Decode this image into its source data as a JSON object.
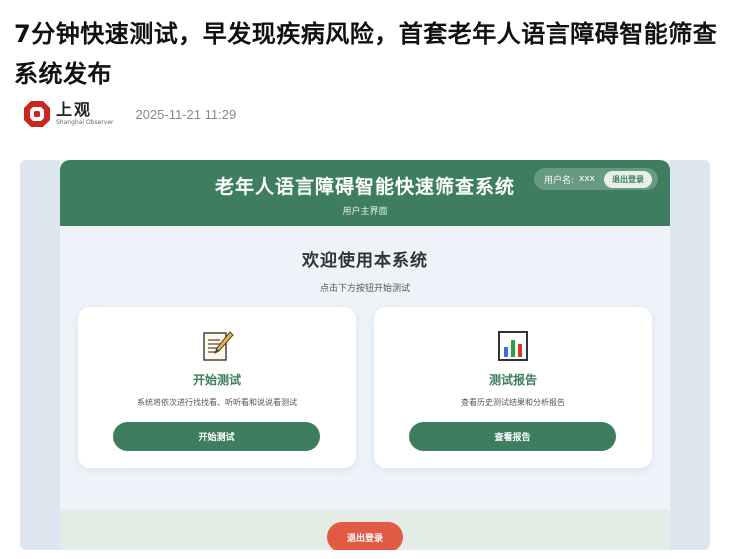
{
  "article": {
    "title": "7分钟快速测试，早发现疾病风险，首套老年人语言障碍智能筛查系统发布",
    "publisher_name_cn": "上观",
    "publisher_name_en": "Shanghai Observer",
    "date": "2025-11-21 11:29"
  },
  "app": {
    "title": "老年人语言障碍智能快速筛查系统",
    "subtitle": "用户主界面",
    "user_label": "用户名:",
    "user_name": "xxx",
    "logout_small_label": "退出登录",
    "welcome_title": "欢迎使用本系统",
    "welcome_subtitle": "点击下方按钮开始测试",
    "cards": [
      {
        "icon": "memo-icon",
        "title": "开始测试",
        "description": "系统将依次进行找找看、听听看和说说看测试",
        "button_label": "开始测试"
      },
      {
        "icon": "bar-chart-icon",
        "title": "测试报告",
        "description": "查看历史测试结果和分析报告",
        "button_label": "查看报告"
      }
    ],
    "logout_button_label": "退出登录"
  },
  "colors": {
    "primary_green": "#3e7d5e",
    "logout_red": "#e15a44",
    "logo_red": "#c8271e",
    "background": "#eef3fa"
  }
}
